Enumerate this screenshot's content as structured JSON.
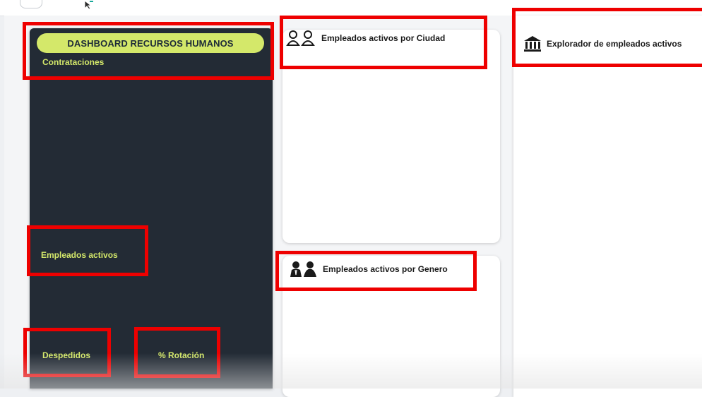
{
  "dashboard": {
    "title": "DASHBOARD RECURSOS HUMANOS"
  },
  "sidebar": {
    "hires_label": "Contrataciones",
    "active_label": "Empleados activos",
    "dismissals_label": "Despedidos",
    "rotation_label": "% Rotación"
  },
  "cards": {
    "city": {
      "title": "Empleados activos por Ciudad",
      "icon": "two-people-icon"
    },
    "gender": {
      "title": "Empleados activos por Genero",
      "icon": "male-female-icon"
    },
    "explorer": {
      "title": "Explorador de empleados activos",
      "icon": "bank-icon"
    }
  },
  "colors": {
    "sidebar_bg": "#232b35",
    "accent": "#d4e86a",
    "highlight": "#ee0000"
  }
}
